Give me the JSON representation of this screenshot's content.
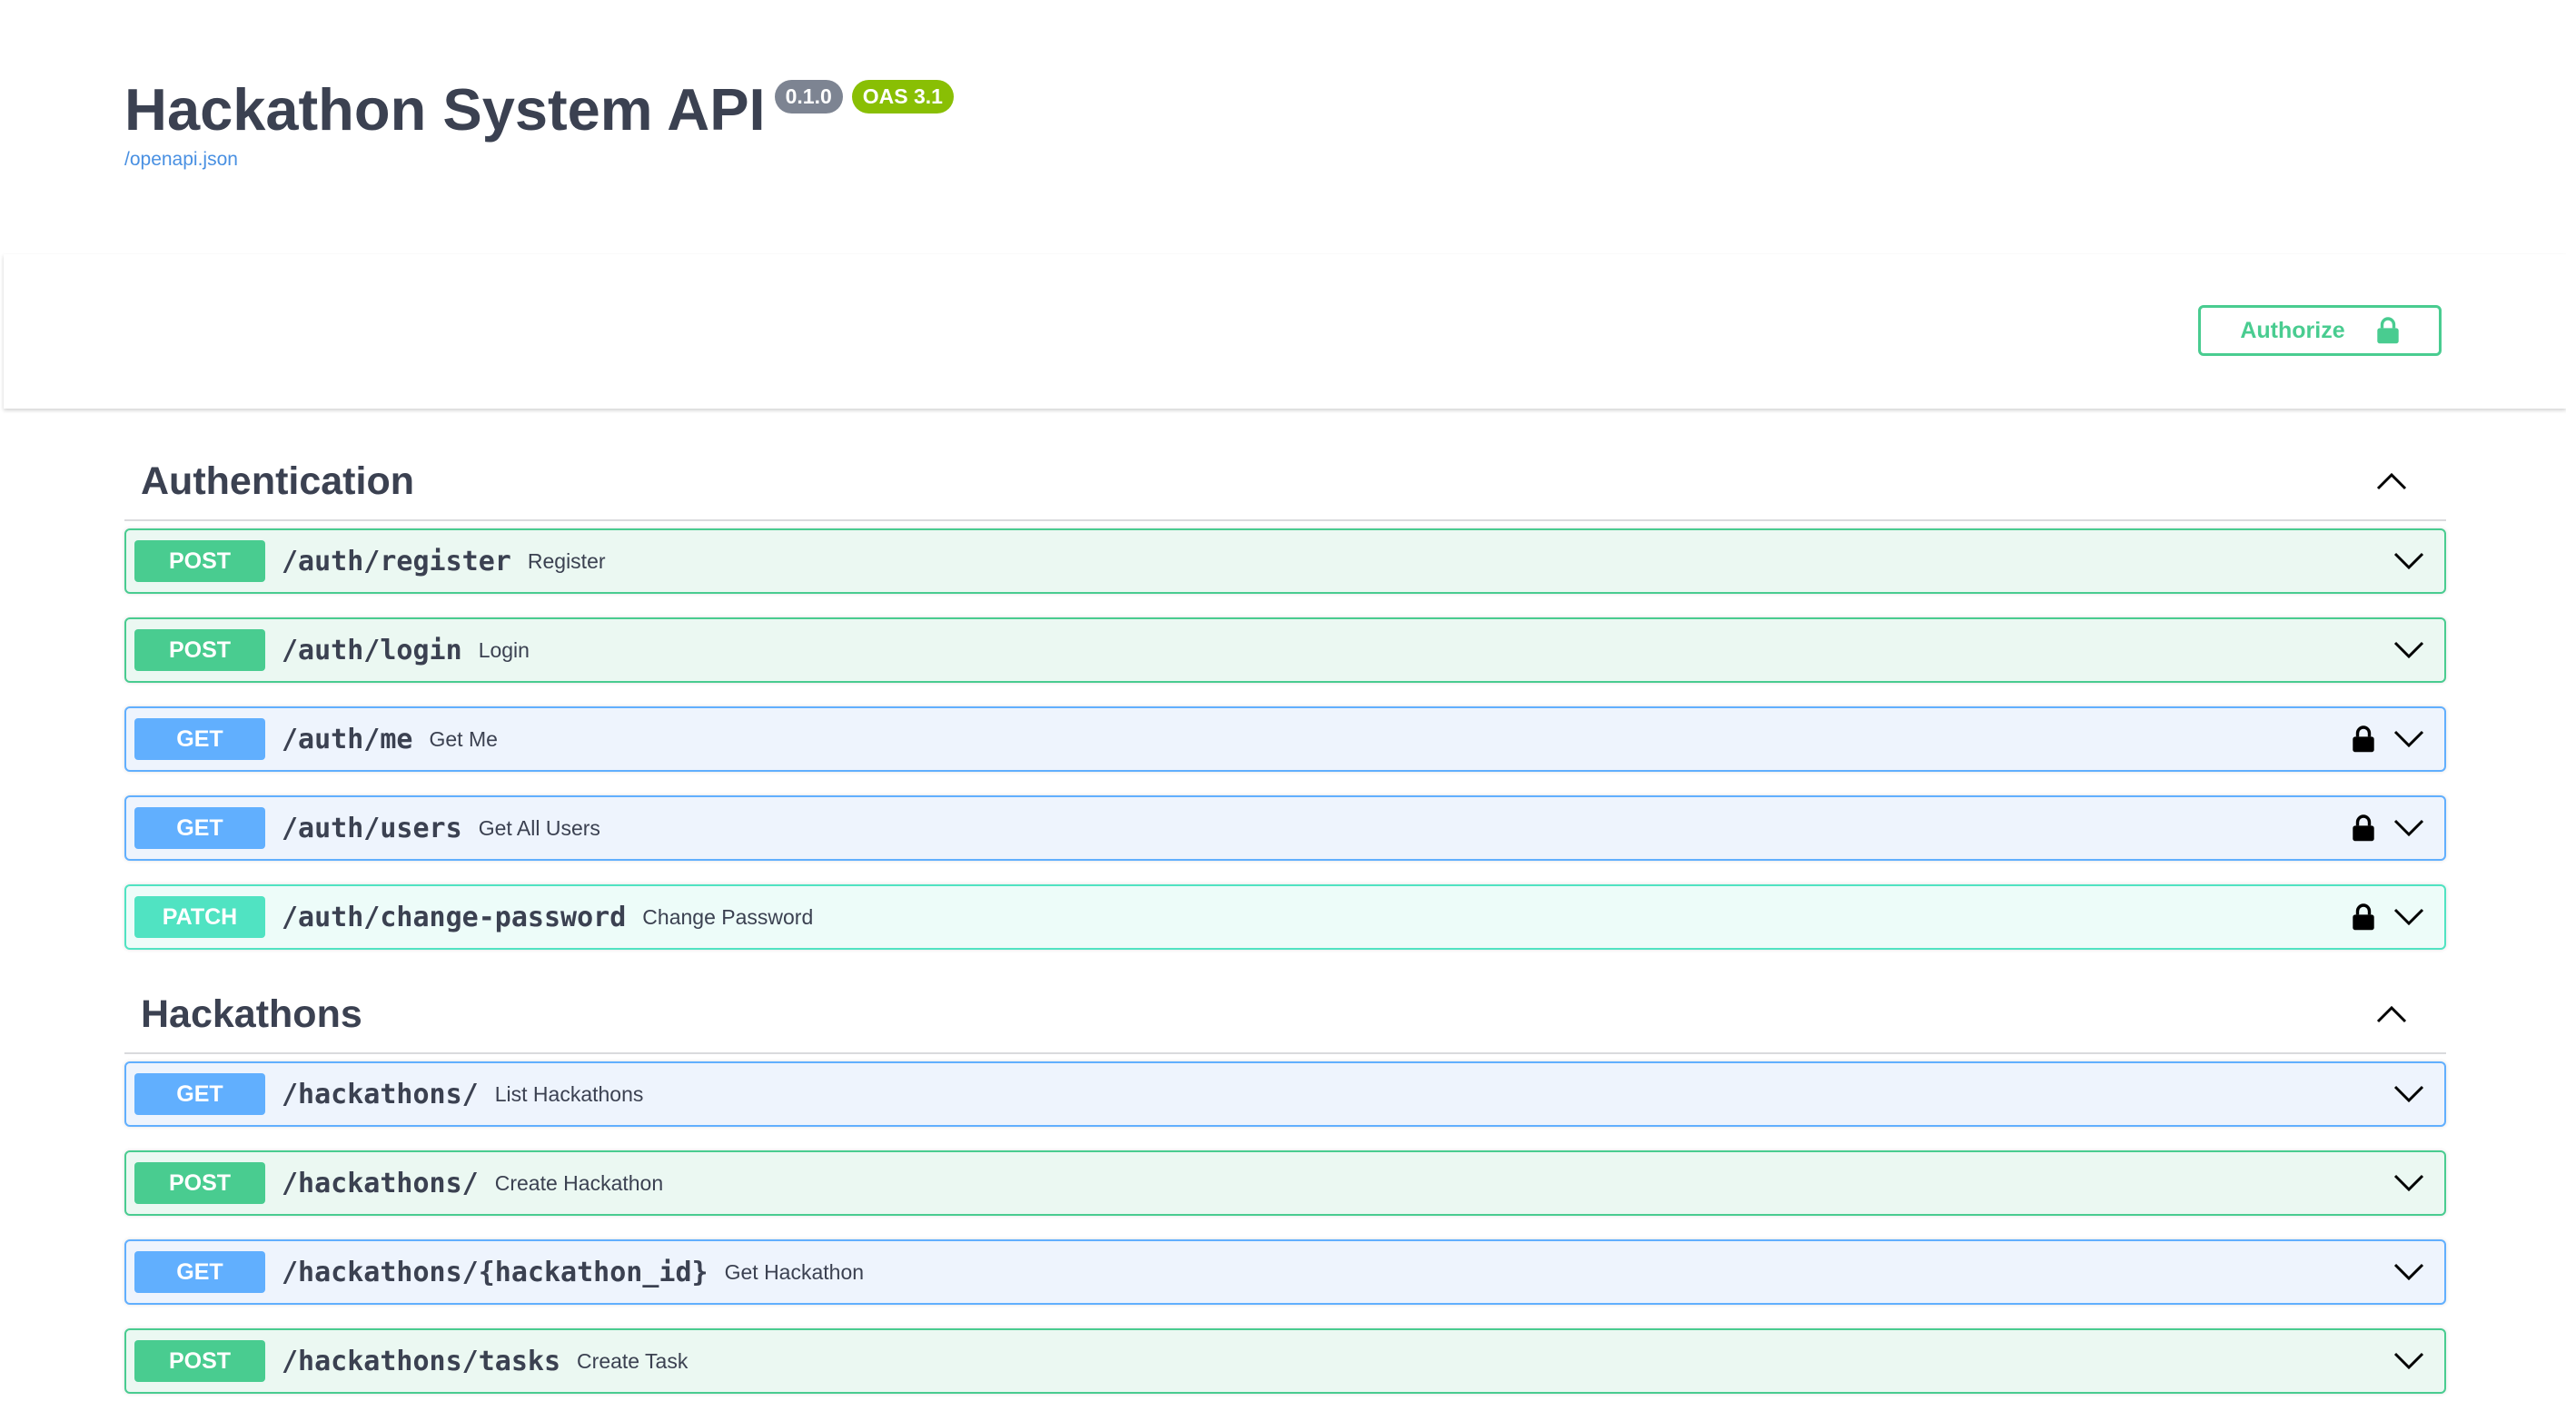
{
  "info": {
    "title": "Hackathon System API",
    "version_badge": "0.1.0",
    "oas_badge": "OAS 3.1",
    "spec_link": "/openapi.json"
  },
  "authorize": {
    "label": "Authorize",
    "icon": "lock-icon"
  },
  "colors": {
    "post": "#49cc90",
    "get": "#61affe",
    "patch": "#50e3c2",
    "text": "#3b4151",
    "link": "#4990e2"
  },
  "tags": [
    {
      "name": "Authentication",
      "expanded": true,
      "operations": [
        {
          "method": "POST",
          "path": "/auth/register",
          "summary": "Register",
          "locked": false
        },
        {
          "method": "POST",
          "path": "/auth/login",
          "summary": "Login",
          "locked": false
        },
        {
          "method": "GET",
          "path": "/auth/me",
          "summary": "Get Me",
          "locked": true
        },
        {
          "method": "GET",
          "path": "/auth/users",
          "summary": "Get All Users",
          "locked": true
        },
        {
          "method": "PATCH",
          "path": "/auth/change-password",
          "summary": "Change Password",
          "locked": true
        }
      ]
    },
    {
      "name": "Hackathons",
      "expanded": true,
      "operations": [
        {
          "method": "GET",
          "path": "/hackathons/",
          "summary": "List Hackathons",
          "locked": false
        },
        {
          "method": "POST",
          "path": "/hackathons/",
          "summary": "Create Hackathon",
          "locked": false
        },
        {
          "method": "GET",
          "path": "/hackathons/{hackathon_id}",
          "summary": "Get Hackathon",
          "locked": false
        },
        {
          "method": "POST",
          "path": "/hackathons/tasks",
          "summary": "Create Task",
          "locked": false
        }
      ]
    }
  ]
}
